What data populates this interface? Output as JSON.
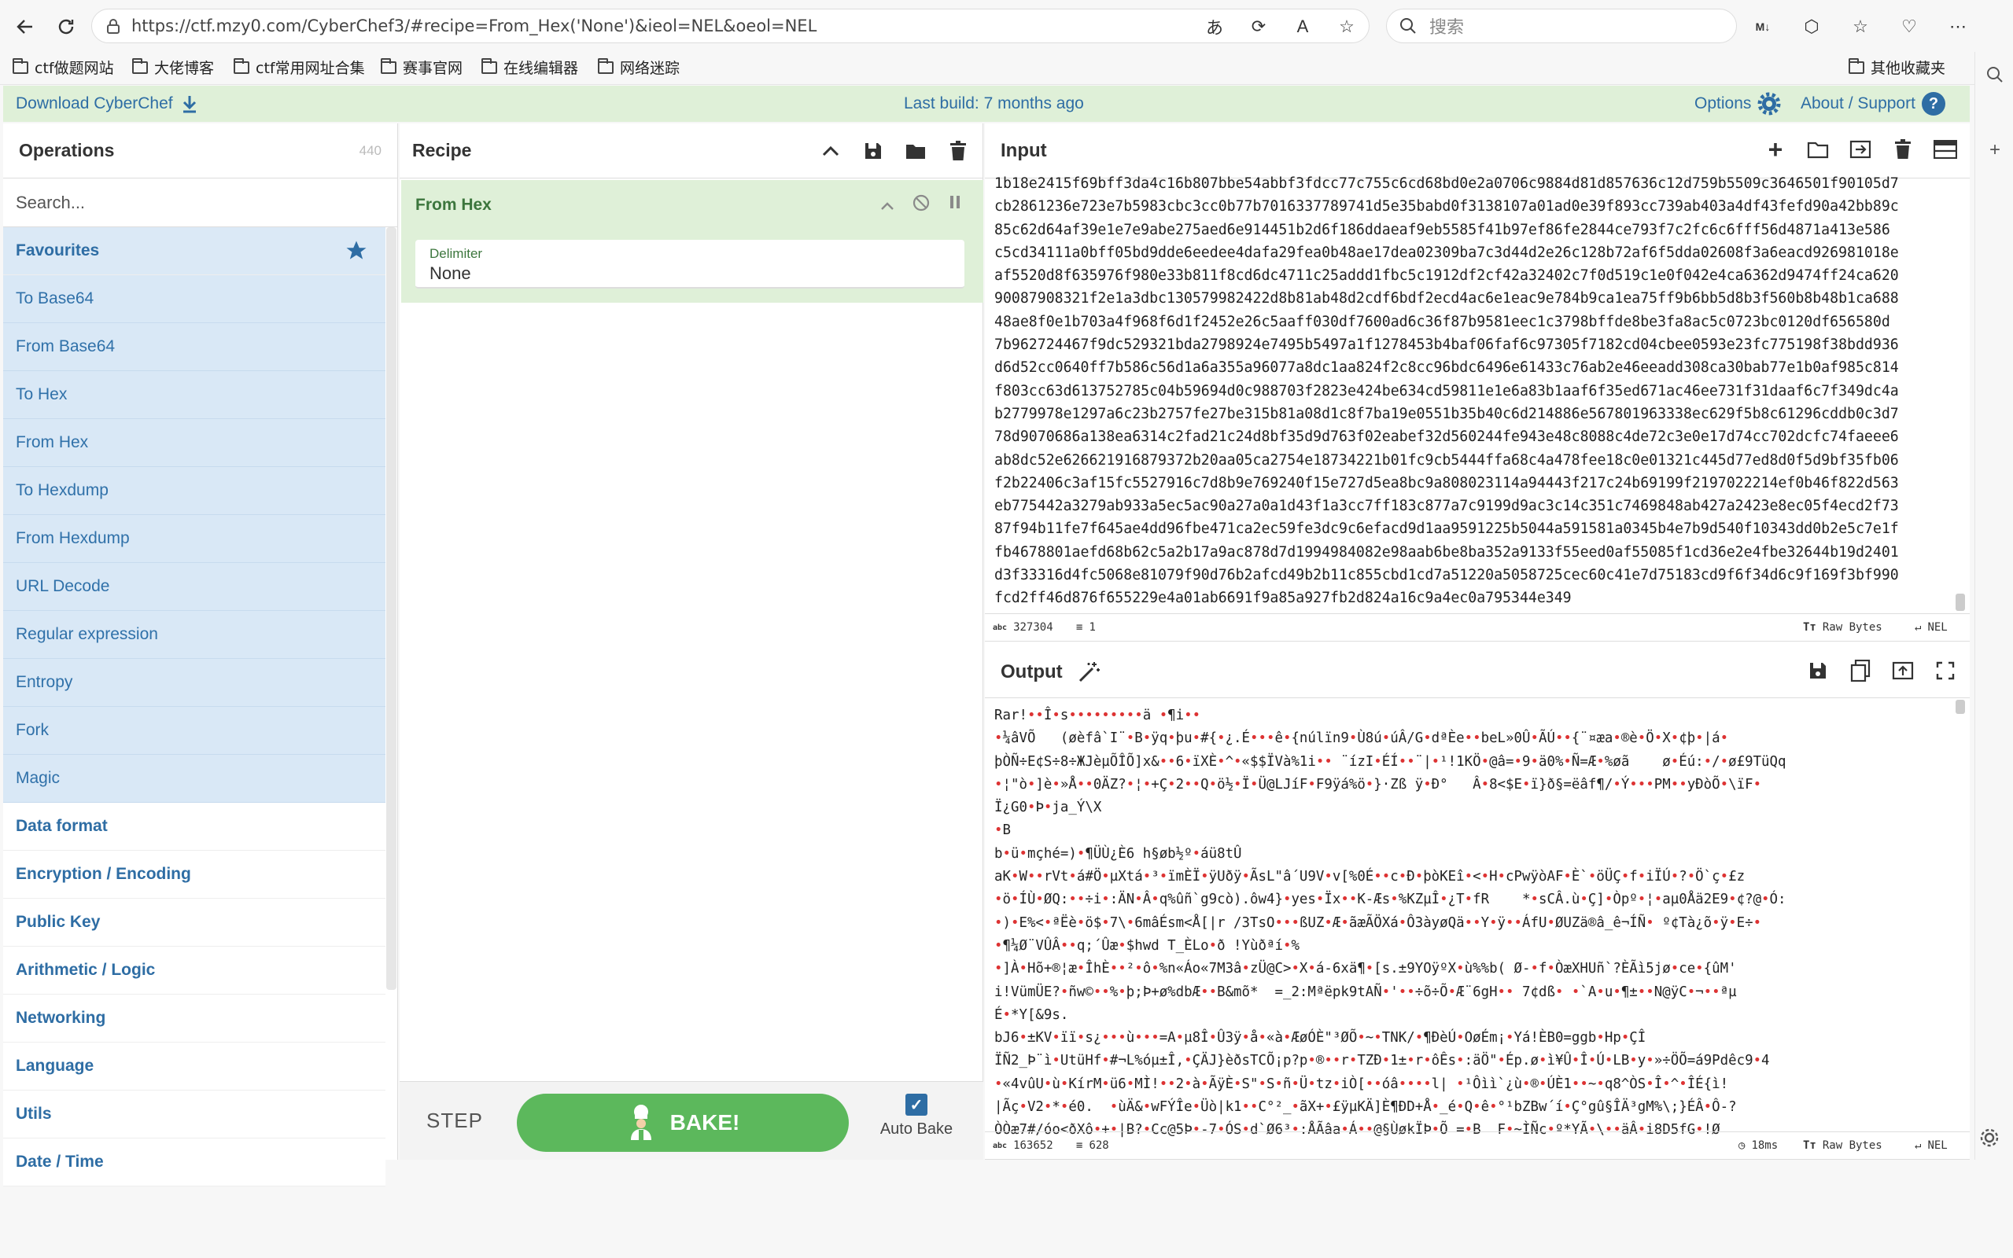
{
  "browser": {
    "url": "https://ctf.mzy0.com/CyberChef3/#recipe=From_Hex('None')&ieol=NEL&oeol=NEL",
    "search_placeholder": "搜索",
    "bookmarks": [
      "ctf做题网站",
      "大佬博客",
      "ctf常用网址合集",
      "赛事官网",
      "在线编辑器",
      "网络迷踪"
    ],
    "other_bookmarks": "其他收藏夹"
  },
  "banner": {
    "download": "Download CyberChef",
    "last_build": "Last build: 7 months ago",
    "options": "Options",
    "about": "About / Support"
  },
  "operations": {
    "title": "Operations",
    "count": "440",
    "search_placeholder": "Search...",
    "favourites": "Favourites",
    "items": [
      "To Base64",
      "From Base64",
      "To Hex",
      "From Hex",
      "To Hexdump",
      "From Hexdump",
      "URL Decode",
      "Regular expression",
      "Entropy",
      "Fork",
      "Magic"
    ],
    "categories": [
      "Data format",
      "Encryption / Encoding",
      "Public Key",
      "Arithmetic / Logic",
      "Networking",
      "Language",
      "Utils",
      "Date / Time"
    ]
  },
  "recipe": {
    "title": "Recipe",
    "ingredient_name": "From Hex",
    "delimiter_label": "Delimiter",
    "delimiter_value": "None",
    "step": "STEP",
    "bake": "BAKE!",
    "autobake": "Auto Bake"
  },
  "input": {
    "title": "Input",
    "lines": [
      "1b18e2415f69bff3da4c16b807bbe54abbf3fdcc77c755c6cd68bd0e2a0706c9884d81d857636c12d759b5509c3646501f90105d7",
      "cb2861236e723e7b5983cbc3cc0b77b7016337789741d5e35babd0f3138107a01ad0e39f893cc739ab403a4df43fefd90a42bb89c",
      "85c62d64af39e1e7e9abe275aed6e914451b2d6f186ddaeaf9eb5585f41b97ef86fe2844ce793f7c2fc6c6fff56d4871a413e586",
      "c5cd34111a0bff05bd9dde6eedee4dafa29fea0b48ae17dea02309ba7c3d44d2e26c128b72af6f5dda02608f3a6eacd926981018e",
      "af5520d8f635976f980e33b811f8cd6dc4711c25addd1fbc5c1912df2cf42a32402c7f0d519c1e0f042e4ca6362d9474ff24ca620",
      "90087908321f2e1a3dbc130579982422d8b81ab48d2cdf6bdf2ecd4ac6e1eac9e784b9ca1ea75ff9b6bb5d8b3f560b8b48b1ca688",
      "48ae8f0e1b703a4f968f6d1f2452e26c5aaff030df7600ad6c36f87b9581eec1c3798bffde8be3fa8ac5c0723bc0120df656580d",
      "7b962724467f9dc529321bda2798924e7495b5497a1f1278453b4baf06faf6c97305f7182cd04cbee0593e23fc775198f38bdd936",
      "d6d52cc0640ff7b586c56d1a6a355a96077a8dc1aa824f2c8cc96bdc6496e61433c76ab2e46eeadd308ca30bab77e1b0af985c814",
      "f803cc63d613752785c04b59694d0c988703f2823e424be634cd59811e1e6a83b1aaf6f35ed671ac46ee731f31daaf6c7f349dc4a",
      "b2779978e1297a6c23b2757fe27be315b81a08d1c8f7ba19e0551b35b40c6d214886e567801963338ec629f5b8c61296cddb0c3d7",
      "78d9070686a138ea6314c2fad21c24d8bf35d9d763f02eabef32d560244fe943e48c8088c4de72c3e0e17d74cc702dcfc74faeee6",
      "ab8dc52e626621916879372b20aa05ca2754e18734221b01fc9cb5444ffa68c4a478fee18c0e01321c445d77ed8d0f5d9bf35fb06",
      "f2b22406c3af15fc5527916c7d8b9e769240f15e727d5ea8bc9a808023114a94443f217c24b69199f2197022214ef0b46f822d563",
      "eb775442a3279ab933a5ec5ac90a27a0a1d43f1a3cc7ff183c877a7c9199d9ac3c14c351c7469848ab427a2423e8ec05f4ecd2f73",
      "87f94b11fe7f645ae4dd96fbe471ca2ec59fe3dc9c6efacd9d1aa9591225b5044a591581a0345b4e7b9d540f10343dd0b2e5c7e1f",
      "fb4678801aefd68b62c5a2b17a9ac878d7d1994984082e98aab6be8ba352a9133f55eed0af55085f1cd36e2e4fbe32644b19d2401",
      "d3f33316d4fc5068e81079f90d76b2afcd49b2b11c855cbd1cd7a51220a5058725cec60c41e7d75183cd9f6f34d6c9f169f3bf990",
      "fcd2ff46d876f655229e4a01ab6691f9a85a927fb2d824a16c9a4ec0a795344e349"
    ],
    "length": "327304",
    "lines_count": "1",
    "raw_bytes": "Raw Bytes",
    "eol": "NEL"
  },
  "output": {
    "title": "Output",
    "lines": [
      "Rar!••Î•s•••••••••ä •¶i••",
      "•¼âVÕ   (øèfâ`I¨•B•ÿq•þu•#{•¿.É•••ê•{núlïn9•Ù8ú•úÂ/G•dªÈe••beL»0Û•ÃÚ••{¨¤æa•®è•Ö•X•¢þ•|á•",
      "þÒÑ÷E¢S÷8÷ЖJèµÕÎÕ]x&••6•ïXÈ•^•«$$ÏVà%1i•• ¨ízI•ÉÍ••¨|•¹!1KÖ•@â=•9•ä0%•Ñ=Æ•%øã    ø•Éú:•/•ø£9TüQq",
      "•¦\"ò•]è•»Å••0ÄZ?•¦•+Ç•2••Q•ö½•Ï•Ü@LJíF•F9ÿá%ö•}·Zß ÿ•Ð°   Â•8<$E•ï}ð§=ëâf¶/•Ý•••PM••yÐòÕ•\\ïF•",
      "Ï¿G0•Þ•ja_Ý\\X",
      "•B",
      "b•ü•mçhé=)•¶ÜÙ¿È6 h§øb½º•áü8tÛ",
      "aK•W••rVt•á#Ö•µXtá•³•ïmÈÏ•ÿUðÿ•ÃsL\"â´U9V•v[%0É••c•Ð•þòKEî•<•H•cPwÿòAF•È`•öÜÇ•f•iÏÚ•?•Ö`ç•£z",
      "•ö•ÍÙ•ØQ:••÷i•:ÄN•Â•q%ûñ`g9cò).ôw4}•yes•Ïx••K-Æs•%KZµÎ•¿T•fR    *•sCÂ.ù•Ç]•Òpº•¦•aµ0Åä2E9•¢?@•Ó:",
      "•)•E%<•ªËè•ö$•7\\•6mâÉsm<Å[|r /3TsO•••ßUZ•Æ•ãæÃÖXá•Ô3àyøQä••Y•ÿ••ÁfU•ØUZä®â_ê¬ÍÑ• º¢Tà¿õ•ÿ•E÷•",
      "•¶¼Ø¨VÛÂ••q;´Ûæ•$hwd T_ÈLo•ð !Yùðªí•%",
      "•]À•Hõ+®¦æ•ÎhÈ••²•ô•%n«Áo«7M3â•zÜ@C>•X•á-6xä¶•[s.±9YOÿºX•ù%%b( Ø-•f•ÒæXHUñ`?ÈÃì5jø•ce•{ûM'",
      "i!VümÜE?•ñw©••%•þ;Þ+ø%dbÆ••B&mõ*  =_2:Mªëpk9tAÑ•'••÷õ÷Õ•Æ¨6gH•• 7¢dß• •`A•u•¶±••N@ÿC•¬••ªµ",
      "É•*Y[&9s.",
      "bJ6•±KV•ïï•s¿•••ù•••=A•µ8Î•Û3ÿ•å•«à•ÆøÓÈ\"³ØÕ•~•TNK/•¶ÐèÚ•OøÉm¡•Yá!ÈB0=ggb•Hp•ÇÎ",
      "ÏÑ2_Þ¨ì•UtüHf•#¬L%óµ±Î,•ÇÄJ}èðsTCÕ¡p?p•®••r•TZÐ•1±•r•ôÊs•:äÖ\"•Ép.ø•ì¥Û•Î•Ú•LB•y•»÷ÖÕ=á9Pdêc9•4",
      "•«4vûU•ù•KírM•ü6•MÌ!••2•à•ÃÿÈ•S\"•S•ñ•Ü•tz•iÒ[••óâ••••l| •¹Ôìì`¿ù•®•ÚÈ1••~•q8^ÒS•Î•^•ÎÉ{ì!",
      "|Ãç•V2•*•é0.  •ùÄ&•wFÝÎe•Üò|k1••C°²_•ãX+•£ÿµKÄ]È¶ÐD+Å•_é•Q•ê•°¹bZBw´í•Ç°gû§ÎÄ³gM%\\;}ÉÂ•Ô-?",
      "ÒÒæ7#/óo<ðXô•+•|B?•Cc@5Þ•-7•ÓS•d`Ø6³•:ÅÃâa•Á••@§ÙøkÏÞ•Õ =•B  F•~ÌÑc•º*YÃ•\\••äÂ•i8D5fG•!Ø"
    ],
    "length": "163652",
    "lines_count": "628",
    "time": "18ms",
    "raw_bytes": "Raw Bytes",
    "eol": "NEL"
  },
  "colors": {
    "banner_bg": "#dff0d8",
    "link_blue": "#2e6da4",
    "ingredient_green": "#3c763d",
    "bake_green": "#5cb85c",
    "favourite_bg": "#d9e8f6",
    "control_char_red": "#d33"
  }
}
